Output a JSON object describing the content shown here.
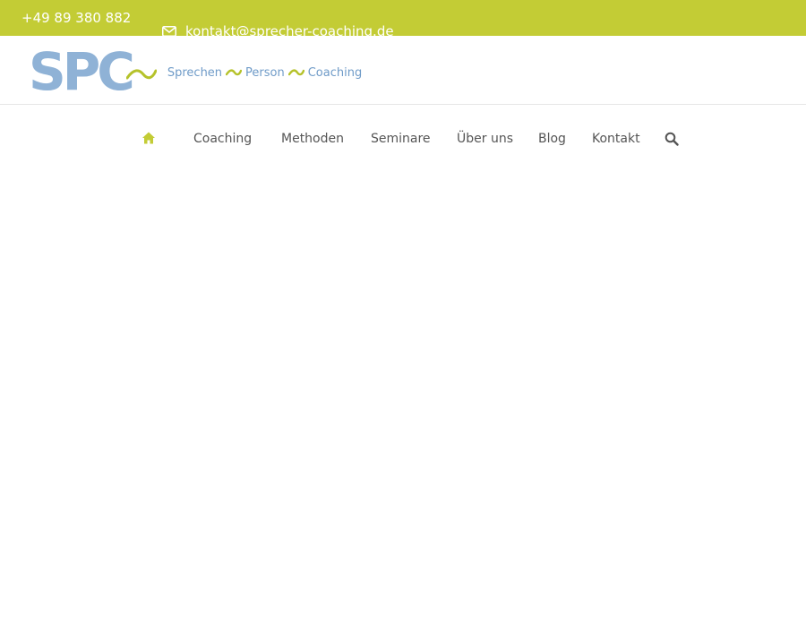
{
  "topbar": {
    "phone": "+49 89 380 882",
    "email": "kontakt@sprecher-coaching.de",
    "background": "#c3cc35"
  },
  "logo": {
    "mark": "SPC",
    "tagline": [
      "Sprechen",
      "Person",
      "Coaching"
    ],
    "mark_color": "#8fb2d6",
    "accent_color": "#b5c22a"
  },
  "nav": {
    "home_icon": "home-icon",
    "items": [
      "Coaching",
      "Methoden",
      "Seminare",
      "Über uns",
      "Blog",
      "Kontakt"
    ],
    "search_icon": "search-icon",
    "home_color": "#c3cc35"
  }
}
